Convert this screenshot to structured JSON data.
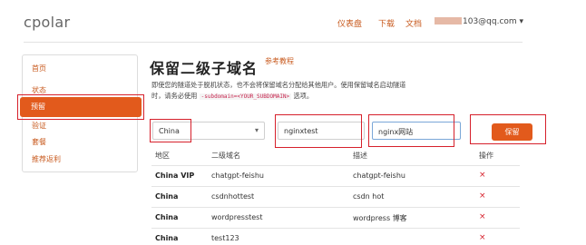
{
  "app": {
    "logo": "cpolar"
  },
  "topnav": {
    "dashboard": "仪表盘",
    "download": "下载",
    "docs": "文档",
    "user": "103@qq.com ▾"
  },
  "sidebar": {
    "items": [
      {
        "label": "首页"
      },
      {
        "label": "状态"
      },
      {
        "label": "预留"
      },
      {
        "label": "验证"
      },
      {
        "label": "套餐"
      },
      {
        "label": "推荐返利"
      }
    ],
    "active_index": 2
  },
  "main": {
    "title": "保留二级子域名",
    "tutorial_link": "参考教程",
    "desc_line1": "即使您的隧道处于脱机状态，也不会将保留域名分配给其他用户。使用保留域名启动隧道",
    "desc_line2_pre": "时，请务必使用",
    "desc_code": "-subdomain=<YOUR_SUBDOMAIN>",
    "desc_line2_post": "选项。"
  },
  "form": {
    "region_value": "China",
    "region_caret": "▾",
    "subdomain_value": "nginxtest",
    "description_value": "nginx网站",
    "save_label": "保留"
  },
  "table": {
    "headers": [
      "地区",
      "二级域名",
      "描述",
      "操作"
    ],
    "rows": [
      {
        "region": "China VIP",
        "subdomain": "chatgpt-feishu",
        "description": "chatgpt-feishu",
        "action": "×"
      },
      {
        "region": "China",
        "subdomain": "csdnhottest",
        "description": "csdn hot",
        "action": "×"
      },
      {
        "region": "China",
        "subdomain": "wordpresstest",
        "description": "wordpress 博客",
        "action": "×"
      },
      {
        "region": "China",
        "subdomain": "test123",
        "description": "",
        "action": "×"
      }
    ]
  },
  "colors": {
    "accent": "#e25a1c",
    "link": "#c85a1e",
    "highlight_box": "#d6202b"
  }
}
